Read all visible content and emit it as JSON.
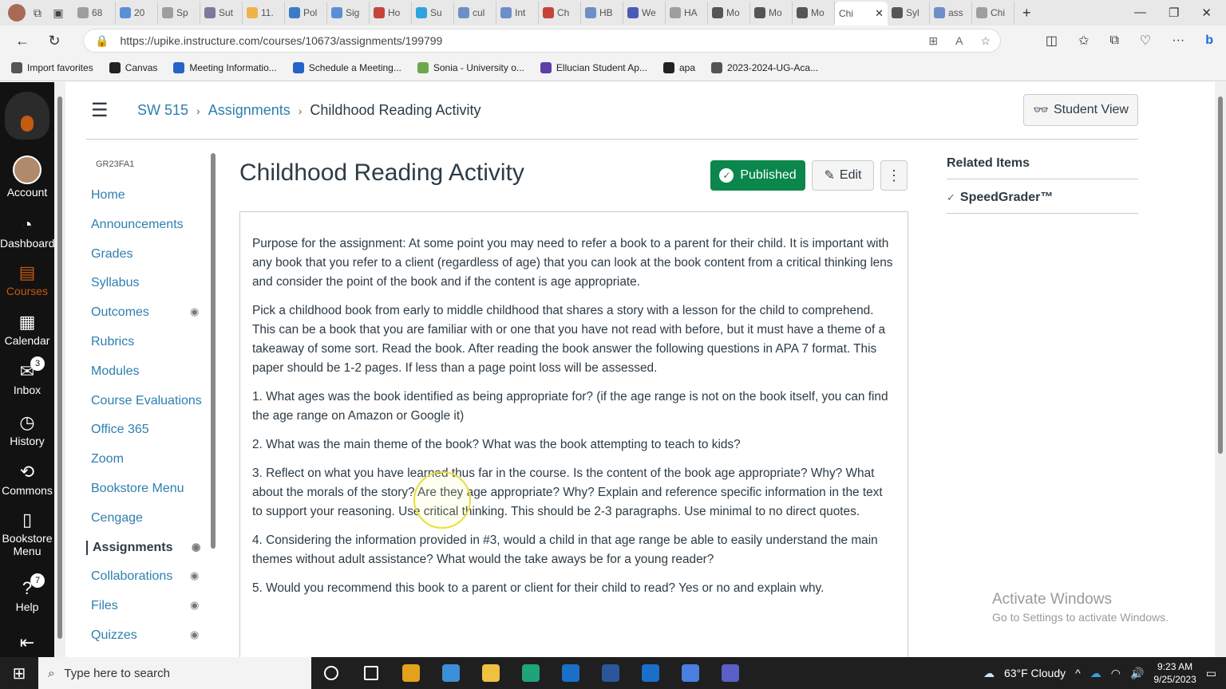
{
  "browser": {
    "tabs": [
      {
        "label": "68",
        "color": "#9e9e9e"
      },
      {
        "label": "20",
        "color": "#5b8fd6"
      },
      {
        "label": "Sp",
        "color": "#9e9e9e"
      },
      {
        "label": "Sut",
        "color": "#7a7a9a"
      },
      {
        "label": "11.",
        "color": "#f0b34a"
      },
      {
        "label": "Pol",
        "color": "#3b7ac9"
      },
      {
        "label": "Sig",
        "color": "#5a8fd8"
      },
      {
        "label": "Ho",
        "color": "#c4433b"
      },
      {
        "label": "Su",
        "color": "#2fa3e0"
      },
      {
        "label": "cul",
        "color": "#6d8fc7"
      },
      {
        "label": "Int",
        "color": "#6d8fc7"
      },
      {
        "label": "Ch",
        "color": "#c4433b"
      },
      {
        "label": "HB",
        "color": "#6d8fc7"
      },
      {
        "label": "We",
        "color": "#4a5ab8"
      },
      {
        "label": "HA",
        "color": "#9e9e9e"
      },
      {
        "label": "Mo",
        "color": "#555555"
      },
      {
        "label": "Mo",
        "color": "#555555"
      },
      {
        "label": "Mo",
        "color": "#555555"
      }
    ],
    "active_tab": "Chi",
    "tabs_after": [
      {
        "label": "Syl",
        "color": "#555555"
      },
      {
        "label": "ass",
        "color": "#6d8fc7"
      },
      {
        "label": "Chi",
        "color": "#9e9e9e"
      }
    ],
    "url": "https://upike.instructure.com/courses/10673/assignments/199799",
    "favorites": [
      {
        "label": "Import favorites",
        "color": "#555555"
      },
      {
        "label": "Canvas",
        "color": "#222222"
      },
      {
        "label": "Meeting Informatio...",
        "color": "#2563c9"
      },
      {
        "label": "Schedule a Meeting...",
        "color": "#2563c9"
      },
      {
        "label": "Sonia - University o...",
        "color": "#6ba84a"
      },
      {
        "label": "Ellucian Student Ap...",
        "color": "#5d3fa8"
      },
      {
        "label": "apa",
        "color": "#222222"
      },
      {
        "label": "2023-2024-UG-Aca...",
        "color": "#555555"
      }
    ]
  },
  "globalnav": {
    "items": [
      {
        "label": "Account",
        "icon": "avatar"
      },
      {
        "label": "Dashboard",
        "icon": "dashboard-icon"
      },
      {
        "label": "Courses",
        "icon": "courses-icon"
      },
      {
        "label": "Calendar",
        "icon": "calendar-icon"
      },
      {
        "label": "Inbox",
        "icon": "inbox-icon",
        "badge": "3"
      },
      {
        "label": "History",
        "icon": "history-icon"
      },
      {
        "label": "Commons",
        "icon": "commons-icon"
      },
      {
        "label": "Bookstore Menu",
        "icon": "book-icon"
      },
      {
        "label": "Help",
        "icon": "help-icon",
        "badge": "7"
      }
    ],
    "active_color": "#c55a11"
  },
  "header": {
    "crumbs": [
      "SW 515",
      "Assignments",
      "Childhood Reading Activity"
    ],
    "student_view": "Student View"
  },
  "coursenav": {
    "term": "GR23FA1",
    "items": [
      {
        "label": "Home",
        "hidden": false
      },
      {
        "label": "Announcements",
        "hidden": false
      },
      {
        "label": "Grades",
        "hidden": false
      },
      {
        "label": "Syllabus",
        "hidden": false
      },
      {
        "label": "Outcomes",
        "hidden": true
      },
      {
        "label": "Rubrics",
        "hidden": false
      },
      {
        "label": "Modules",
        "hidden": false
      },
      {
        "label": "Course Evaluations",
        "hidden": false
      },
      {
        "label": "Office 365",
        "hidden": false
      },
      {
        "label": "Zoom",
        "hidden": false
      },
      {
        "label": "Bookstore Menu",
        "hidden": false
      },
      {
        "label": "Cengage",
        "hidden": false
      },
      {
        "label": "Assignments",
        "hidden": true,
        "active": true
      },
      {
        "label": "Collaborations",
        "hidden": true
      },
      {
        "label": "Files",
        "hidden": true
      },
      {
        "label": "Quizzes",
        "hidden": true
      }
    ]
  },
  "assignment": {
    "title": "Childhood Reading Activity",
    "published_label": "Published",
    "edit_label": "Edit",
    "paragraphs": [
      "Purpose for the assignment: At some point you may need to refer a book to a parent for their child. It is important with any book that you refer to a client (regardless of age) that you can look at the book content from a critical thinking lens and consider the point of the book and if the content is age appropriate.",
      "Pick a childhood book from early to middle childhood that shares a story with a lesson for the child to comprehend. This can be a book that you are familiar with or one that you have not read with before, but it must have a theme of a takeaway of some sort. Read the book. After reading the book answer the following questions in APA 7 format. This paper should be 1-2 pages. If less than a page point loss will be assessed.",
      "1. What ages was the book identified as being appropriate for? (if the age range is not on the book itself, you can find the age range on Amazon or Google it)",
      "2. What was the main theme of the book? What was the book attempting to teach to kids?",
      "3. Reflect on what you have learned thus far in the course. Is the content of the book age appropriate? Why? What about the morals of the story? Are they age appropriate? Why?  Explain and reference specific information in the text to support your reasoning. Use critical thinking. This should be 2-3 paragraphs. Use minimal to no direct quotes.",
      "4. Considering the information provided in #3, would a child in that age range be able to easily understand the main themes without adult assistance? What would the take aways be for a young reader?",
      "5. Would you recommend this book to a parent or client for their child to read? Yes or no and explain why."
    ]
  },
  "related": {
    "title": "Related Items",
    "speedgrader": "SpeedGrader™"
  },
  "watermark": {
    "line1": "Activate Windows",
    "line2": "Go to Settings to activate Windows."
  },
  "taskbar": {
    "search_placeholder": "Type here to search",
    "weather": "63°F  Cloudy",
    "time": "9:23 AM",
    "date": "9/25/2023",
    "apps": [
      {
        "name": "cortana",
        "color": "#ffffff"
      },
      {
        "name": "task-view",
        "color": "#ffffff"
      },
      {
        "name": "chrome",
        "color": "#e3a21a"
      },
      {
        "name": "store",
        "color": "#3b8fd8"
      },
      {
        "name": "file-explorer",
        "color": "#f0c040"
      },
      {
        "name": "edge",
        "color": "#1fa37a"
      },
      {
        "name": "outlook",
        "color": "#1a6fc9"
      },
      {
        "name": "word",
        "color": "#2b579a"
      },
      {
        "name": "outlook-2",
        "color": "#1a6fc9"
      },
      {
        "name": "settings",
        "color": "#4a7fe0"
      },
      {
        "name": "teams",
        "color": "#5b5fc7"
      }
    ]
  }
}
